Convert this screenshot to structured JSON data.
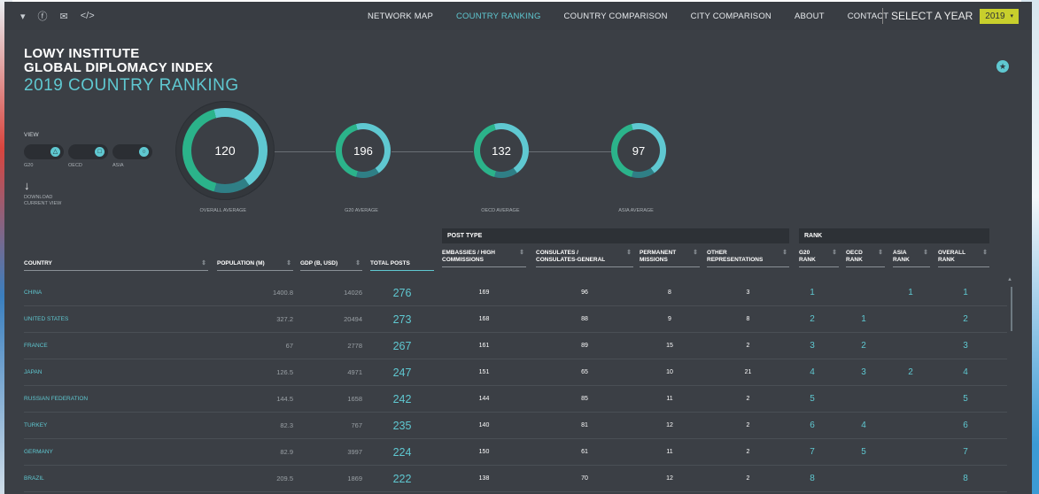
{
  "social": {
    "twitter": "▾",
    "facebook": "ⓕ",
    "email": "✉",
    "embed": "</>"
  },
  "nav": [
    "NETWORK MAP",
    "COUNTRY RANKING",
    "COUNTRY COMPARISON",
    "CITY COMPARISON",
    "ABOUT",
    "CONTACT"
  ],
  "nav_active": "COUNTRY RANKING",
  "year": {
    "label": "SELECT A YEAR",
    "value": "2019",
    "caret": "▾"
  },
  "title": {
    "line1": "LOWY INSTITUTE",
    "line2": "GLOBAL DIPLOMACY INDEX",
    "line3": "2019 COUNTRY RANKING"
  },
  "view": {
    "label": "VIEW",
    "toggles": [
      {
        "name": "G20",
        "icon": "triangle-icon",
        "glyph": "△"
      },
      {
        "name": "OECD",
        "icon": "square-icon",
        "glyph": "□"
      },
      {
        "name": "ASIA",
        "icon": "circle-icon",
        "glyph": "○"
      }
    ],
    "download_icon": "↓",
    "download_label": "DOWNLOAD CURRENT VIEW"
  },
  "averages": [
    {
      "value": "120",
      "label": "OVERALL AVERAGE",
      "fill": 0.86
    },
    {
      "value": "196",
      "label": "G20 AVERAGE",
      "fill": 0.86
    },
    {
      "value": "132",
      "label": "OECD AVERAGE",
      "fill": 0.86
    },
    {
      "value": "97",
      "label": "ASIA AVERAGE",
      "fill": 0.86
    }
  ],
  "groups": {
    "post_type": "POST TYPE",
    "rank": "RANK"
  },
  "columns": {
    "country": "COUNTRY",
    "population": "POPULATION (M)",
    "gdp": "GDP (B, USD)",
    "total": "TOTAL POSTS",
    "embassies": "EMBASSIES / HIGH COMMISSIONS",
    "consulates": "CONSULATES / CONSULATES-GENERAL",
    "missions": "PERMANENT MISSIONS",
    "other": "OTHER REPRESENTATIONS",
    "g20": "G20 RANK",
    "oecd": "OECD RANK",
    "asia": "ASIA RANK",
    "overall": "OVERALL RANK"
  },
  "rows": [
    {
      "country": "CHINA",
      "population": "1400.8",
      "gdp": "14026",
      "total": "276",
      "embassies": "169",
      "consulates": "96",
      "missions": "8",
      "other": "3",
      "g20": "1",
      "oecd": "",
      "asia": "1",
      "overall": "1"
    },
    {
      "country": "UNITED STATES",
      "population": "327.2",
      "gdp": "20494",
      "total": "273",
      "embassies": "168",
      "consulates": "88",
      "missions": "9",
      "other": "8",
      "g20": "2",
      "oecd": "1",
      "asia": "",
      "overall": "2"
    },
    {
      "country": "FRANCE",
      "population": "67",
      "gdp": "2778",
      "total": "267",
      "embassies": "161",
      "consulates": "89",
      "missions": "15",
      "other": "2",
      "g20": "3",
      "oecd": "2",
      "asia": "",
      "overall": "3"
    },
    {
      "country": "JAPAN",
      "population": "126.5",
      "gdp": "4971",
      "total": "247",
      "embassies": "151",
      "consulates": "65",
      "missions": "10",
      "other": "21",
      "g20": "4",
      "oecd": "3",
      "asia": "2",
      "overall": "4"
    },
    {
      "country": "RUSSIAN FEDERATION",
      "population": "144.5",
      "gdp": "1658",
      "total": "242",
      "embassies": "144",
      "consulates": "85",
      "missions": "11",
      "other": "2",
      "g20": "5",
      "oecd": "",
      "asia": "",
      "overall": "5"
    },
    {
      "country": "TURKEY",
      "population": "82.3",
      "gdp": "767",
      "total": "235",
      "embassies": "140",
      "consulates": "81",
      "missions": "12",
      "other": "2",
      "g20": "6",
      "oecd": "4",
      "asia": "",
      "overall": "6"
    },
    {
      "country": "GERMANY",
      "population": "82.9",
      "gdp": "3997",
      "total": "224",
      "embassies": "150",
      "consulates": "61",
      "missions": "11",
      "other": "2",
      "g20": "7",
      "oecd": "5",
      "asia": "",
      "overall": "7"
    },
    {
      "country": "BRAZIL",
      "population": "209.5",
      "gdp": "1869",
      "total": "222",
      "embassies": "138",
      "consulates": "70",
      "missions": "12",
      "other": "2",
      "g20": "8",
      "oecd": "",
      "asia": "",
      "overall": "8"
    }
  ],
  "colors": {
    "accent": "#5fc8d1",
    "accent_dark": "#2bb38a",
    "panel": "#3b3f45",
    "year_box": "#c8cf2c"
  }
}
